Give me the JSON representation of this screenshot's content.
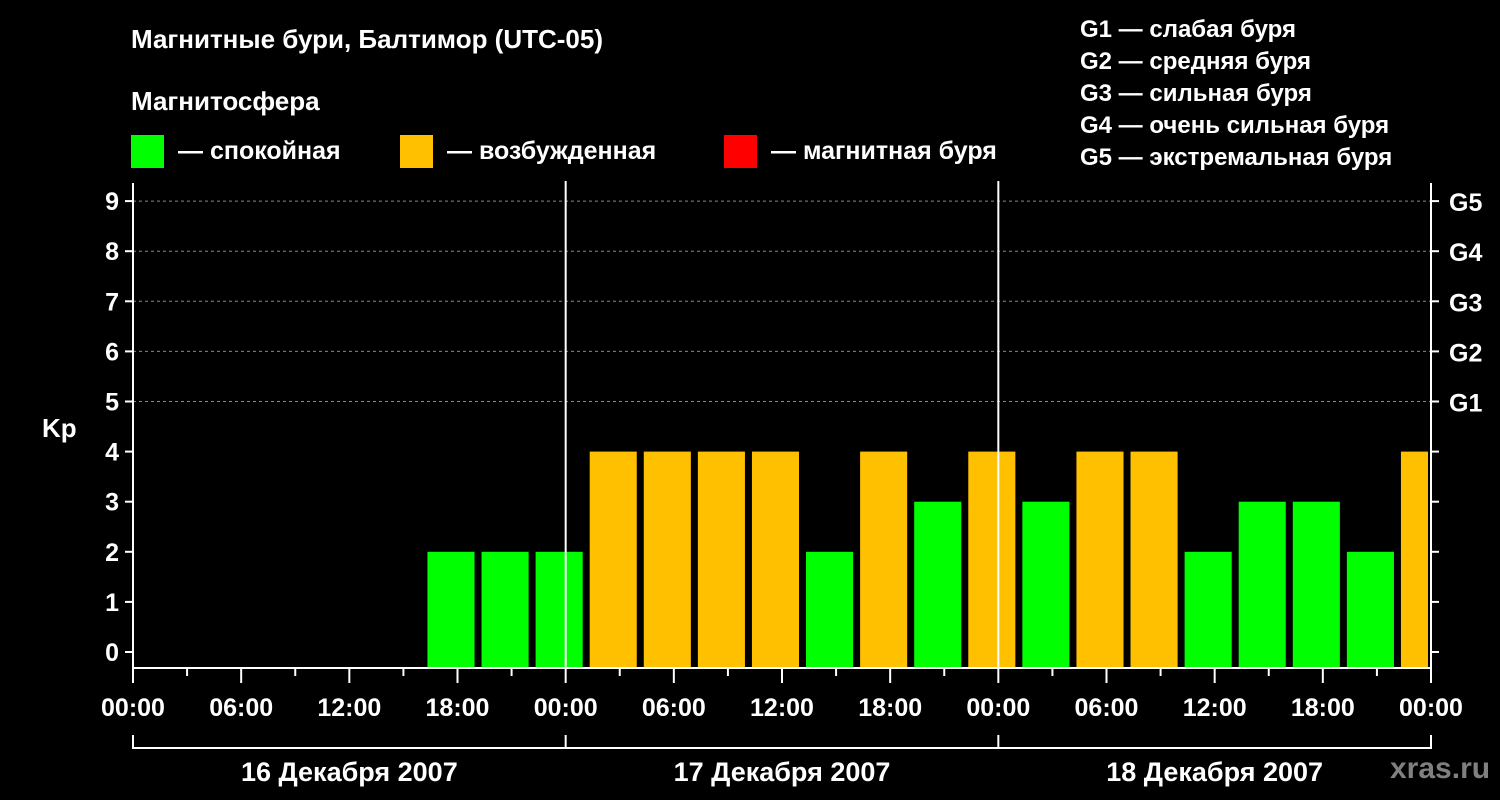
{
  "title": "Магнитные бури, Балтимор (UTC-05)",
  "subtitle": "Магнитосфера",
  "legend": [
    {
      "label": "— спокойная",
      "color": "#00ff00"
    },
    {
      "label": "— возбужденная",
      "color": "#ffc000"
    },
    {
      "label": "— магнитная буря",
      "color": "#ff0000"
    }
  ],
  "g_scale": [
    "G1 — слабая буря",
    "G2 — средняя буря",
    "G3 — сильная буря",
    "G4 — очень сильная буря",
    "G5 — экстремальная буря"
  ],
  "watermark": "xras.ru",
  "chart_data": {
    "type": "bar",
    "title": "Магнитные бури, Балтимор (UTC-05)",
    "ylabel": "Kp",
    "ylim": [
      0,
      9
    ],
    "yticks": [
      0,
      1,
      2,
      3,
      4,
      5,
      6,
      7,
      8,
      9
    ],
    "right_ticks": [
      {
        "kp": 5,
        "label": "G1"
      },
      {
        "kp": 6,
        "label": "G2"
      },
      {
        "kp": 7,
        "label": "G3"
      },
      {
        "kp": 8,
        "label": "G4"
      },
      {
        "kp": 9,
        "label": "G5"
      }
    ],
    "xtick_labels": [
      "00:00",
      "06:00",
      "12:00",
      "18:00",
      "00:00",
      "06:00",
      "12:00",
      "18:00",
      "00:00",
      "06:00",
      "12:00",
      "18:00",
      "00:00"
    ],
    "days": [
      "16 Декабря 2007",
      "17 Декабря 2007",
      "18 Декабря 2007"
    ],
    "bar_interval_hours": 3,
    "first_bar_start_hour": 16,
    "values": [
      2,
      2,
      2,
      4,
      4,
      4,
      4,
      2,
      4,
      3,
      4,
      3,
      4,
      4,
      2,
      3,
      3,
      2,
      4
    ],
    "colors": {
      "quiet": "#00ff00",
      "active": "#ffc000",
      "storm": "#ff0000"
    },
    "grid": true
  }
}
